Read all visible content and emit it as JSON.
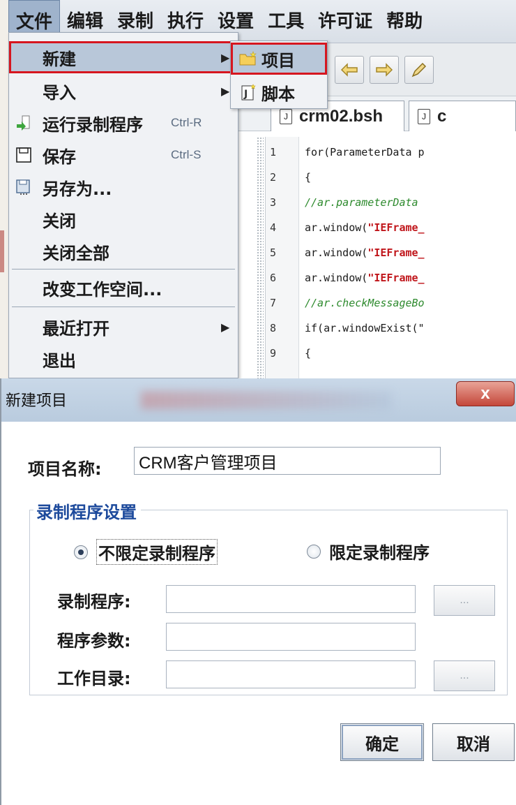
{
  "menubar": {
    "items": [
      "文件",
      "编辑",
      "录制",
      "执行",
      "设置",
      "工具",
      "许可证",
      "帮助"
    ]
  },
  "file_menu": {
    "items": [
      {
        "label": "新建",
        "arrow": "▶",
        "icon": ""
      },
      {
        "label": "导入",
        "arrow": "▶",
        "icon": ""
      },
      {
        "label": "运行录制程序",
        "shortcut": "Ctrl-R",
        "icon": "run-record-icon"
      },
      {
        "label": "保存",
        "shortcut": "Ctrl-S",
        "icon": "save-icon"
      },
      {
        "label": "另存为...",
        "icon": "save-as-icon"
      },
      {
        "label": "关闭"
      },
      {
        "label": "关闭全部"
      },
      {
        "label": "改变工作空间..."
      },
      {
        "label": "最近打开",
        "arrow": "▶"
      },
      {
        "label": "退出"
      }
    ]
  },
  "sub_menu": {
    "items": [
      {
        "label": "项目",
        "icon": "folder-new-icon"
      },
      {
        "label": "脚本",
        "icon": "script-new-icon"
      }
    ]
  },
  "editor": {
    "tabs": [
      "crm02.bsh",
      "c"
    ],
    "lines": [
      {
        "n": "1",
        "text": "for(ParameterData p"
      },
      {
        "n": "2",
        "text": "{"
      },
      {
        "n": "3",
        "text": "//ar.parameterData"
      },
      {
        "n": "4",
        "pre": "ar.window(",
        "str": "\"IEFrame_"
      },
      {
        "n": "5",
        "pre": "ar.window(",
        "str": "\"IEFrame_"
      },
      {
        "n": "6",
        "pre": "ar.window(",
        "str": "\"IEFrame_"
      },
      {
        "n": "7",
        "text": "//ar.checkMessageBo"
      },
      {
        "n": "8",
        "text": "if(ar.windowExist(\""
      },
      {
        "n": "9",
        "text": "{"
      }
    ]
  },
  "dialog": {
    "title": "新建项目",
    "close": "x",
    "project_name_label": "项目名称:",
    "project_name_value": "CRM客户管理项目",
    "group_title": "录制程序设置",
    "radio_unlimited": "不限定录制程序",
    "radio_limited": "限定录制程序",
    "field_program": "录制程序:",
    "field_params": "程序参数:",
    "field_workdir": "工作目录:",
    "browse": "...",
    "ok": "确定",
    "cancel": "取消"
  },
  "colors": {
    "highlight_border": "#d6161f",
    "menu_bg": "#f0f2f5",
    "group_title": "#1d4a9c",
    "string_red": "#c0161b",
    "comment_green": "#2d8a2d"
  }
}
